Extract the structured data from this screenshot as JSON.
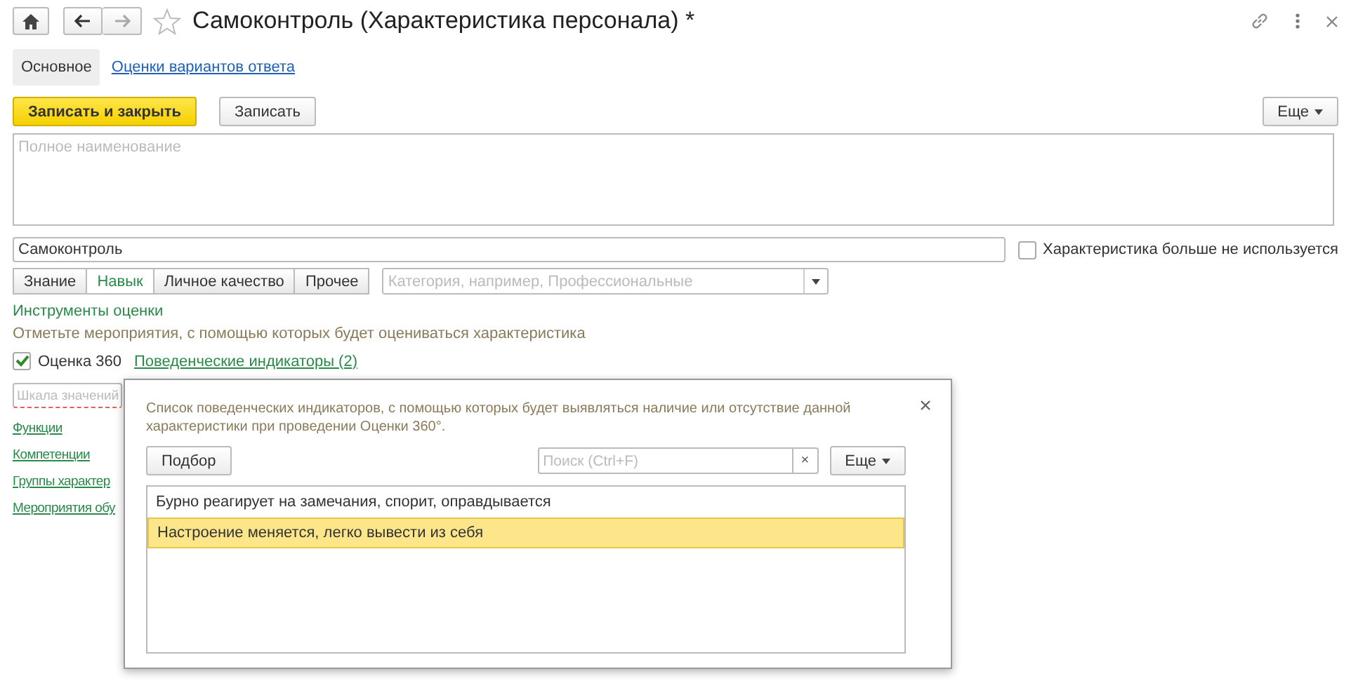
{
  "window": {
    "title": "Самоконтроль (Характеристика персонала) *"
  },
  "tabs": [
    {
      "label": "Основное",
      "selected": true
    },
    {
      "label": "Оценки вариантов ответа",
      "selected": false
    }
  ],
  "toolbar": {
    "primary": "Записать и закрыть",
    "secondary": "Записать",
    "more": "Еще"
  },
  "full_name": {
    "placeholder": "Полное наименование"
  },
  "name": {
    "value": "Самоконтроль"
  },
  "unused": {
    "label": "Характеристика больше не используется",
    "checked": false
  },
  "types": [
    {
      "label": "Знание",
      "selected": false
    },
    {
      "label": "Навык",
      "selected": true
    },
    {
      "label": "Личное качество",
      "selected": false
    },
    {
      "label": "Прочее",
      "selected": false
    }
  ],
  "category": {
    "placeholder": "Категория, например, Профессиональные"
  },
  "assessment": {
    "heading": "Инструменты оценки",
    "hint": "Отметьте мероприятия, с помощью которых будет оцениваться характеристика",
    "checkbox": {
      "label": "Оценка 360",
      "checked": true
    },
    "link": "Поведенческие индикаторы (2)"
  },
  "scale": {
    "placeholder": "Шкала значений"
  },
  "links": [
    "Функции",
    "Компетенции",
    "Группы характер",
    "Мероприятия обу"
  ],
  "dialog": {
    "description": "Список поведенческих индикаторов, с помощью которых будет выявляться наличие или отсутствие данной характеристики при проведении Оценки 360°.",
    "pick": "Подбор",
    "search": {
      "placeholder": "Поиск (Ctrl+F)"
    },
    "clear": "×",
    "more": "Еще",
    "rows": [
      {
        "text": "Бурно реагирует на замечания, спорит, оправдывается",
        "selected": false
      },
      {
        "text": "Настроение меняется, легко вывести из себя",
        "selected": true
      }
    ]
  }
}
